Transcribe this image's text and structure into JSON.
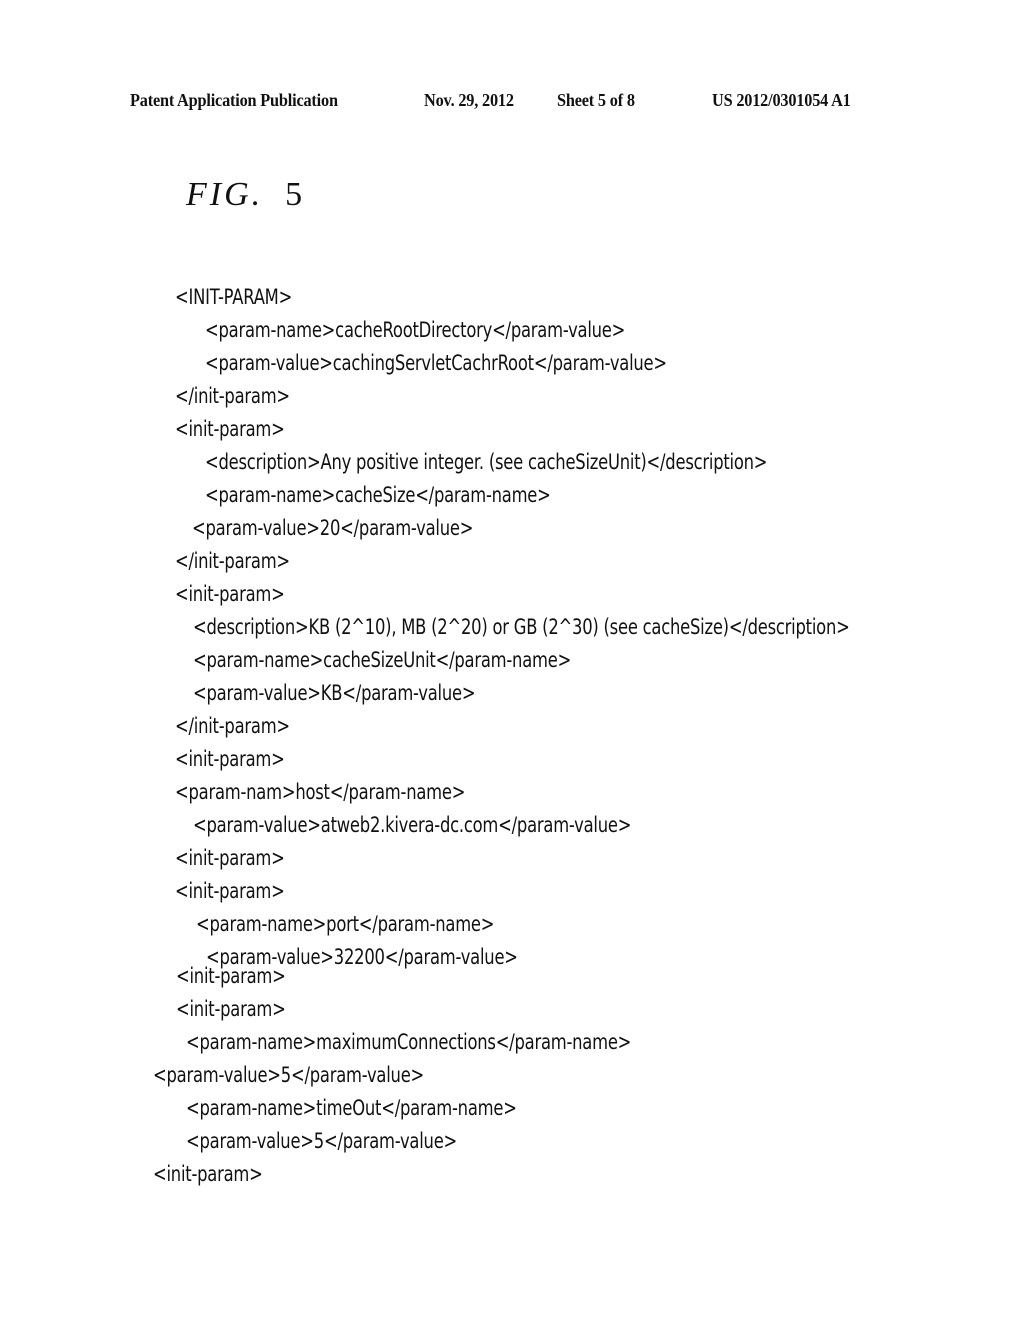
{
  "header": {
    "publication_type": "Patent Application Publication",
    "date": "Nov. 29, 2012",
    "sheet": "Sheet 5 of 8",
    "publication_number": "US 2012/0301054 A1"
  },
  "figure": {
    "label": "FIG.",
    "number": "5"
  },
  "code_lines": [
    {
      "indent": 0,
      "text": "<INIT-PARAM>"
    },
    {
      "indent": 1,
      "text": "<param-name>cacheRootDirectory</param-value>"
    },
    {
      "indent": 1,
      "text": "<param-value>cachingServletCachrRoot</param-value>"
    },
    {
      "indent": 0,
      "text": "</init-param>"
    },
    {
      "indent": 0,
      "text": "<init-param>"
    },
    {
      "indent": 1,
      "text": "<description>Any positive integer. (see cacheSizeUnit)</description>"
    },
    {
      "indent": 1,
      "text": "<param-name>cacheSize</param-name>"
    },
    {
      "indent": 1,
      "text": "<param-value>20</param-value>"
    },
    {
      "indent": 0,
      "text": "</init-param>"
    },
    {
      "indent": 0,
      "text": "<init-param>"
    },
    {
      "indent": 1,
      "text": "<description>KB (2^10), MB (2^20) or GB (2^30) (see cacheSize)</description>"
    },
    {
      "indent": 1,
      "text": "<param-name>cacheSizeUnit</param-name>"
    },
    {
      "indent": 1,
      "text": "<param-value>KB</param-value>"
    },
    {
      "indent": 0,
      "text": "</init-param>"
    },
    {
      "indent": 0,
      "text": "<init-param>"
    },
    {
      "indent": 0,
      "text": "<param-nam>host</param-name>"
    },
    {
      "indent": 1,
      "text": "<param-value>atweb2.kivera-dc.com</param-value>"
    },
    {
      "indent": 0,
      "text": "<init-param>"
    },
    {
      "indent": 0,
      "text": "<init-param>"
    },
    {
      "indent": 1,
      "text": "<param-name>port</param-name>"
    },
    {
      "indent": 1,
      "text": "<param-value>32200</param-value>"
    },
    {
      "indent": 0,
      "text": "<init-param>"
    },
    {
      "indent": 0,
      "text": "<init-param>"
    },
    {
      "indent": 1,
      "text": "<param-name>maximumConnections</param-name>"
    },
    {
      "indent": 0,
      "text": "<param-value>5</param-value>"
    },
    {
      "indent": 1,
      "text": "<param-name>timeOut</param-name>"
    },
    {
      "indent": 1,
      "text": "<param-value>5</param-value>"
    },
    {
      "indent": 0,
      "text": "<init-param>"
    }
  ]
}
